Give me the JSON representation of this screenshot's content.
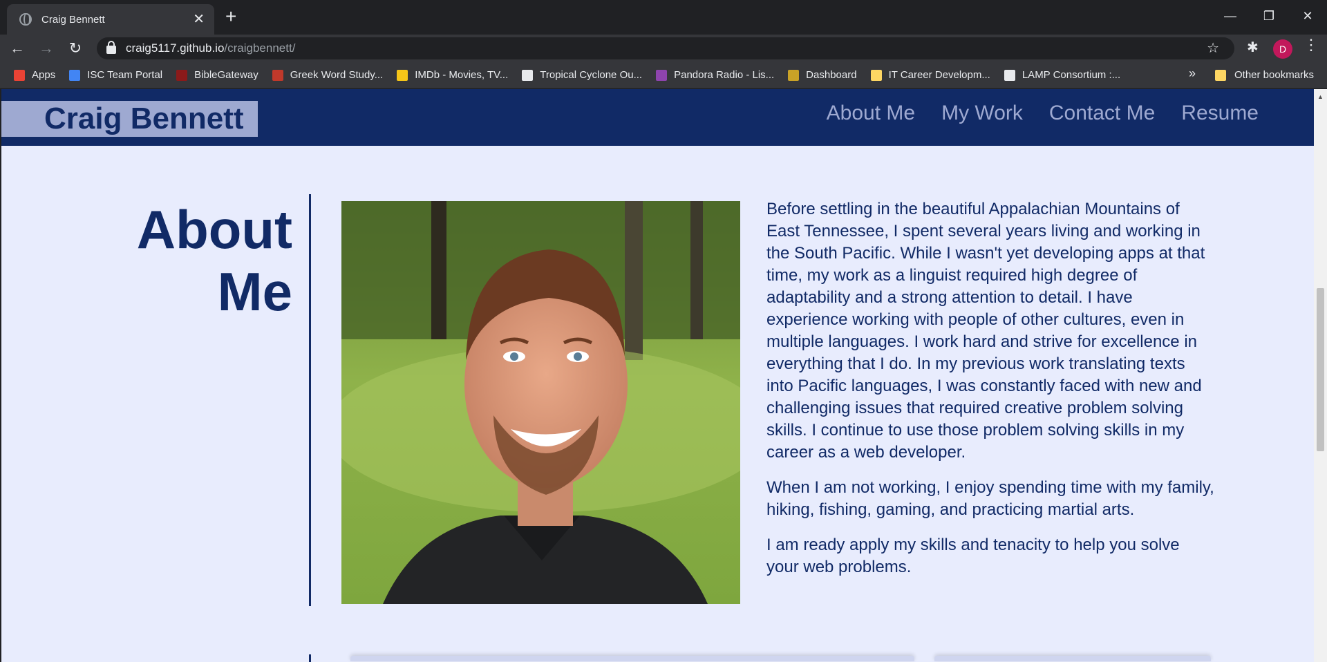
{
  "browser": {
    "tab_title": "Craig Bennett",
    "url_host": "craig5117.github.io",
    "url_path": "/craigbennett/",
    "avatar_letter": "D",
    "bookmarks": [
      {
        "label": "Apps",
        "icon": "apps-grid-icon",
        "color": "#ea4335"
      },
      {
        "label": "ISC Team Portal",
        "icon": "portal-icon",
        "color": "#4285f4"
      },
      {
        "label": "BibleGateway",
        "icon": "biblegateway-icon",
        "color": "#8b1a1a"
      },
      {
        "label": "Greek Word Study...",
        "icon": "greek-study-icon",
        "color": "#c0392b"
      },
      {
        "label": "IMDb - Movies, TV...",
        "icon": "imdb-icon",
        "color": "#f5c518"
      },
      {
        "label": "Tropical Cyclone Ou...",
        "icon": "globe-icon",
        "color": "#e8eaed"
      },
      {
        "label": "Pandora Radio - Lis...",
        "icon": "pandora-icon",
        "color": "#8e44ad"
      },
      {
        "label": "Dashboard",
        "icon": "vanderbilt-icon",
        "color": "#c9a227"
      },
      {
        "label": "IT Career Developm...",
        "icon": "folder-doc-icon",
        "color": "#fdd663"
      },
      {
        "label": "LAMP Consortium :...",
        "icon": "lamp-icon",
        "color": "#e8eaed"
      }
    ],
    "more": "»",
    "other_bookmarks": "Other bookmarks"
  },
  "site": {
    "name": "Craig Bennett",
    "nav": [
      "About Me",
      "My Work",
      "Contact Me",
      "Resume"
    ],
    "section_title_line1": "About",
    "section_title_line2": "Me",
    "bio": [
      "Before settling in the beautiful Appalachian Mountains of East Tennessee, I spent several years living and working in the South Pacific. While I wasn't yet developing apps at that time, my work as a linguist required high degree of adaptability and a strong attention to detail. I have experience working with people of other cultures, even in multiple languages. I work hard and strive for excellence in everything that I do. In my previous work translating texts into Pacific languages, I was constantly faced with new and challenging issues that required creative problem solving skills. I continue to use those problem solving skills in my career as a web developer.",
      "When I am not working, I enjoy spending time with my family, hiking, fishing, gaming, and practicing martial arts.",
      "I am ready apply my skills and tenacity to help you solve your web problems."
    ]
  },
  "colors": {
    "navy": "#112a66",
    "nav_link": "#9ea9d1",
    "page_bg": "#e8ecfd"
  }
}
